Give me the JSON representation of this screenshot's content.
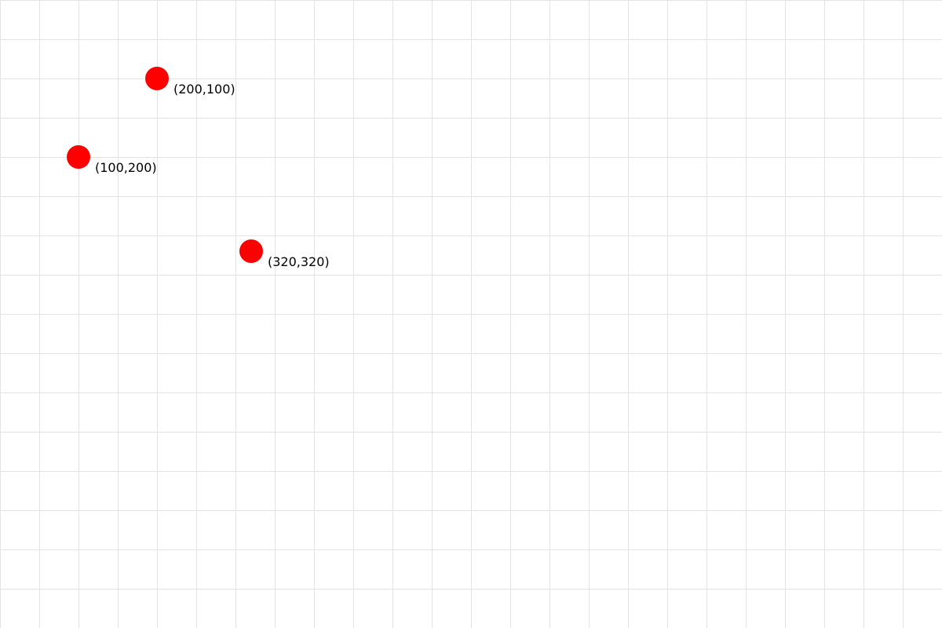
{
  "canvas": {
    "grid": true,
    "grid_color": "#e3e3e3",
    "background_color": "#ffffff"
  },
  "markers": [
    {
      "label": "(200,100)",
      "color": "#ff0000"
    },
    {
      "label": "(100,200)",
      "color": "#ff0000"
    },
    {
      "label": "(320,320)",
      "color": "#ff0000"
    }
  ]
}
